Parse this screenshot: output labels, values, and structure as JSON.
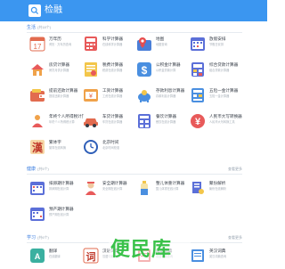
{
  "header": {
    "title": "检融"
  },
  "icons": {
    "search": "search-icon"
  },
  "colors": {
    "header": "#3b96f0",
    "section": "#3b7ee0",
    "watermark": "#3ac24a"
  },
  "sections": [
    {
      "title": "生活",
      "count": "(共18个)",
      "more": ""
    },
    {
      "title": "健康",
      "count": "(共5个)",
      "more": "查看更多"
    },
    {
      "title": "学习",
      "count": "(共6个)",
      "more": "查看更多"
    }
  ],
  "life_tools": [
    {
      "name": "万年历",
      "desc": "黄历 · 万年历查询"
    },
    {
      "name": "科学计算器",
      "desc": "在线科学计算器"
    },
    {
      "name": "地图",
      "desc": "地图查询"
    },
    {
      "name": "放假安排",
      "desc": "节假日安排"
    },
    {
      "name": "房贷计算器",
      "desc": "房贷月供计算器"
    },
    {
      "name": "税费计算器",
      "desc": "税费在线计算器"
    },
    {
      "name": "公积金计算器",
      "desc": "公积金贷款计算"
    },
    {
      "name": "综合贷款计算器",
      "desc": "组合贷款计算器"
    },
    {
      "name": "提前还款计算器",
      "desc": "提前还款计算器"
    },
    {
      "name": "工资计算器",
      "desc": "工资在线计算器"
    },
    {
      "name": "存款利息计算器",
      "desc": "存款利息计算器"
    },
    {
      "name": "五险一金计算器",
      "desc": "五险一金计算器"
    },
    {
      "name": "年终个人所得税计算器",
      "desc": "年终个人所得税计算"
    },
    {
      "name": "车贷计算器",
      "desc": "车贷在线计算器"
    },
    {
      "name": "餐饮计算器",
      "desc": "餐饮在线计算器"
    },
    {
      "name": "人民币大写转换器",
      "desc": "人民币大写转换工具"
    },
    {
      "name": "繁体字",
      "desc": "繁简在线转换"
    },
    {
      "name": "北京时间",
      "desc": "北京时间校准"
    }
  ],
  "health_tools": [
    {
      "name": "排卵期计算器",
      "desc": "排卵期在线计算"
    },
    {
      "name": "安全期计算器",
      "desc": "安全期在线计算"
    },
    {
      "name": "整儿体重计算器",
      "desc": "整儿体重在线计算"
    },
    {
      "name": "聚份解析",
      "desc": "聚份在线解析"
    },
    {
      "name": "预产期计算器",
      "desc": "预产期在线计算"
    }
  ],
  "study_tools": [
    {
      "name": "翻译",
      "desc": "在线翻译"
    },
    {
      "name": "汉语词典",
      "desc": "汉语词典查询"
    },
    {
      "name": "成语词典",
      "desc": "成语词典查询"
    },
    {
      "name": "英汉词典",
      "desc": "英汉词典查询"
    }
  ],
  "watermark": "便民库"
}
